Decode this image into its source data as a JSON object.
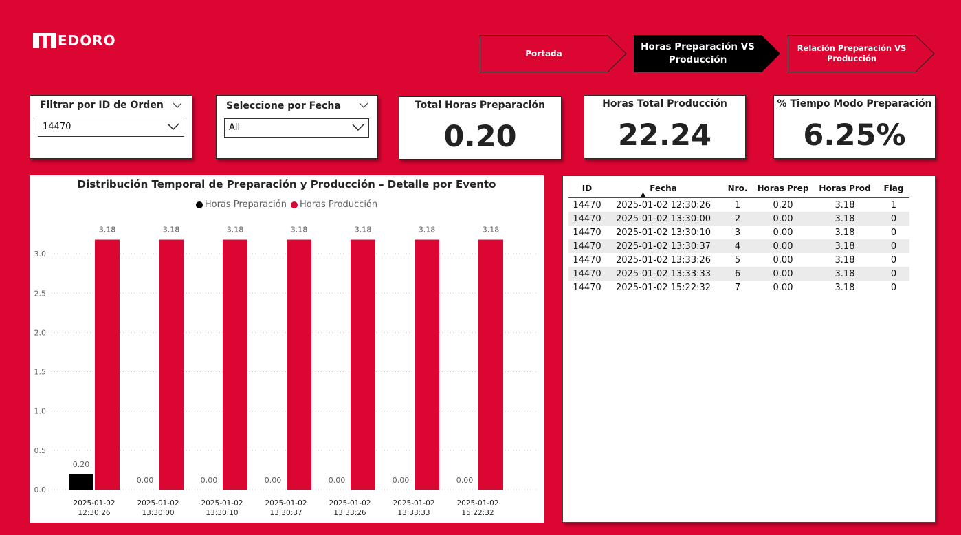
{
  "brand": {
    "name": "EDORO"
  },
  "nav": [
    {
      "label": "Portada",
      "active": false
    },
    {
      "label": "Horas Preparación VS Producción",
      "active": true
    },
    {
      "label": "Relación Preparación VS Producción",
      "active": false
    }
  ],
  "filters": {
    "order": {
      "title": "Filtrar por ID de Orden",
      "value": "14470"
    },
    "date": {
      "title": "Seleccione por Fecha",
      "value": "All"
    }
  },
  "kpis": [
    {
      "title": "Total Horas Preparación",
      "value": "0.20"
    },
    {
      "title": "Horas Total Producción",
      "value": "22.24"
    },
    {
      "title": "% Tiempo Modo Preparación",
      "value": "6.25%"
    }
  ],
  "colors": {
    "background": "#DC0633",
    "preparacion": "#000000",
    "produccion": "#DC0633"
  },
  "chart_data": {
    "type": "bar",
    "title": "Distribución Temporal de Preparación y Producción – Detalle por Evento",
    "categories": [
      [
        "2025-01-02",
        "12:30:26"
      ],
      [
        "2025-01-02",
        "13:30:00"
      ],
      [
        "2025-01-02",
        "13:30:10"
      ],
      [
        "2025-01-02",
        "13:30:37"
      ],
      [
        "2025-01-02",
        "13:33:26"
      ],
      [
        "2025-01-02",
        "13:33:33"
      ],
      [
        "2025-01-02",
        "15:22:32"
      ]
    ],
    "series": [
      {
        "name": "Horas Preparación",
        "color": "#000000",
        "values": [
          0.2,
          0.0,
          0.0,
          0.0,
          0.0,
          0.0,
          0.0
        ],
        "labels": [
          "0.20",
          "0.00",
          "0.00",
          "0.00",
          "0.00",
          "0.00",
          "0.00"
        ]
      },
      {
        "name": "Horas Producción",
        "color": "#DC0633",
        "values": [
          3.18,
          3.18,
          3.18,
          3.18,
          3.18,
          3.18,
          3.18
        ],
        "labels": [
          "3.18",
          "3.18",
          "3.18",
          "3.18",
          "3.18",
          "3.18",
          "3.18"
        ]
      }
    ],
    "ylim": [
      0,
      3.0
    ],
    "yticks": [
      "0.0",
      "0.5",
      "1.0",
      "1.5",
      "2.0",
      "2.5",
      "3.0"
    ],
    "grid": true,
    "legend": "top-center"
  },
  "table": {
    "columns": [
      "ID",
      "Fecha",
      "Nro.",
      "Horas Prep",
      "Horas Prod",
      "Flag"
    ],
    "rows": [
      [
        "14470",
        "2025-01-02 12:30:26",
        "1",
        "0.20",
        "3.18",
        "1"
      ],
      [
        "14470",
        "2025-01-02 13:30:00",
        "2",
        "0.00",
        "3.18",
        "0"
      ],
      [
        "14470",
        "2025-01-02 13:30:10",
        "3",
        "0.00",
        "3.18",
        "0"
      ],
      [
        "14470",
        "2025-01-02 13:30:37",
        "4",
        "0.00",
        "3.18",
        "0"
      ],
      [
        "14470",
        "2025-01-02 13:33:26",
        "5",
        "0.00",
        "3.18",
        "0"
      ],
      [
        "14470",
        "2025-01-02 13:33:33",
        "6",
        "0.00",
        "3.18",
        "0"
      ],
      [
        "14470",
        "2025-01-02 15:22:32",
        "7",
        "0.00",
        "3.18",
        "0"
      ]
    ]
  }
}
